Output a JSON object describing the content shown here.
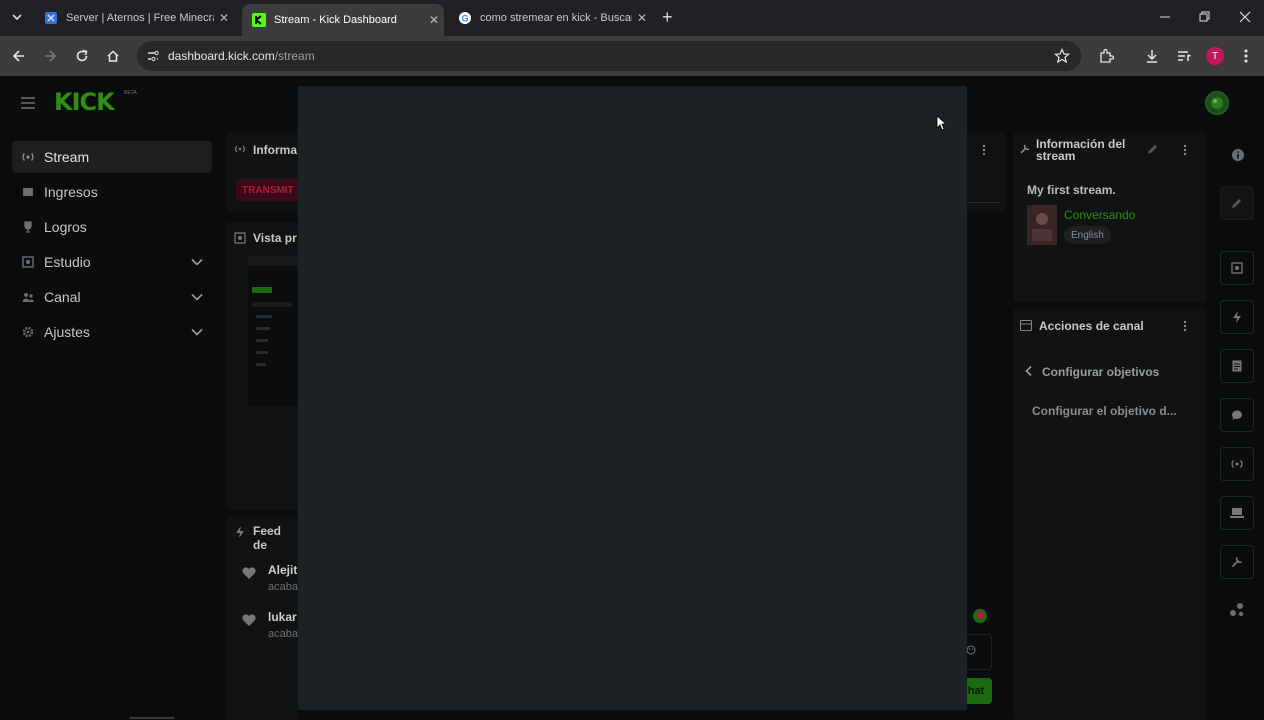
{
  "browser": {
    "tabs": [
      {
        "title": "Server | Aternos | Free Minecraft",
        "favicon": "aternos-icon"
      },
      {
        "title": "Stream - Kick Dashboard",
        "favicon": "kick-icon"
      },
      {
        "title": "como stremear en kick - Buscar",
        "favicon": "google-icon"
      }
    ],
    "address": {
      "domain": "dashboard.kick.com",
      "path": "/stream"
    },
    "profile_initial": "T"
  },
  "logo": {
    "text": "KICK",
    "badge": "BETA"
  },
  "sidebar": {
    "items": [
      {
        "label": "Stream",
        "icon": "broadcast-icon"
      },
      {
        "label": "Ingresos",
        "icon": "wallet-icon"
      },
      {
        "label": "Logros",
        "icon": "trophy-icon"
      },
      {
        "label": "Estudio",
        "icon": "studio-icon"
      },
      {
        "label": "Canal",
        "icon": "users-icon"
      },
      {
        "label": "Ajustes",
        "icon": "gear-icon"
      }
    ]
  },
  "center": {
    "info_title": "Informa",
    "status_badge": "TRANSMIT",
    "preview_title": "Vista pr",
    "feed_title": "Feed de",
    "feed": [
      {
        "name": "Alejit",
        "sub": "acaba"
      },
      {
        "name": "lukar",
        "sub": "acaba"
      }
    ],
    "chat_button": "hat"
  },
  "right": {
    "info_title": "Información del stream",
    "stream_title": "My first stream.",
    "category": "Conversando",
    "language": "English",
    "actions_title": "Acciones de canal",
    "goal_back": "Configurar objetivos",
    "goal_item": "Configurar el objetivo d..."
  },
  "colors": {
    "brand": "#53fc18",
    "badge": "#e0114f",
    "profile": "#c2185b"
  }
}
